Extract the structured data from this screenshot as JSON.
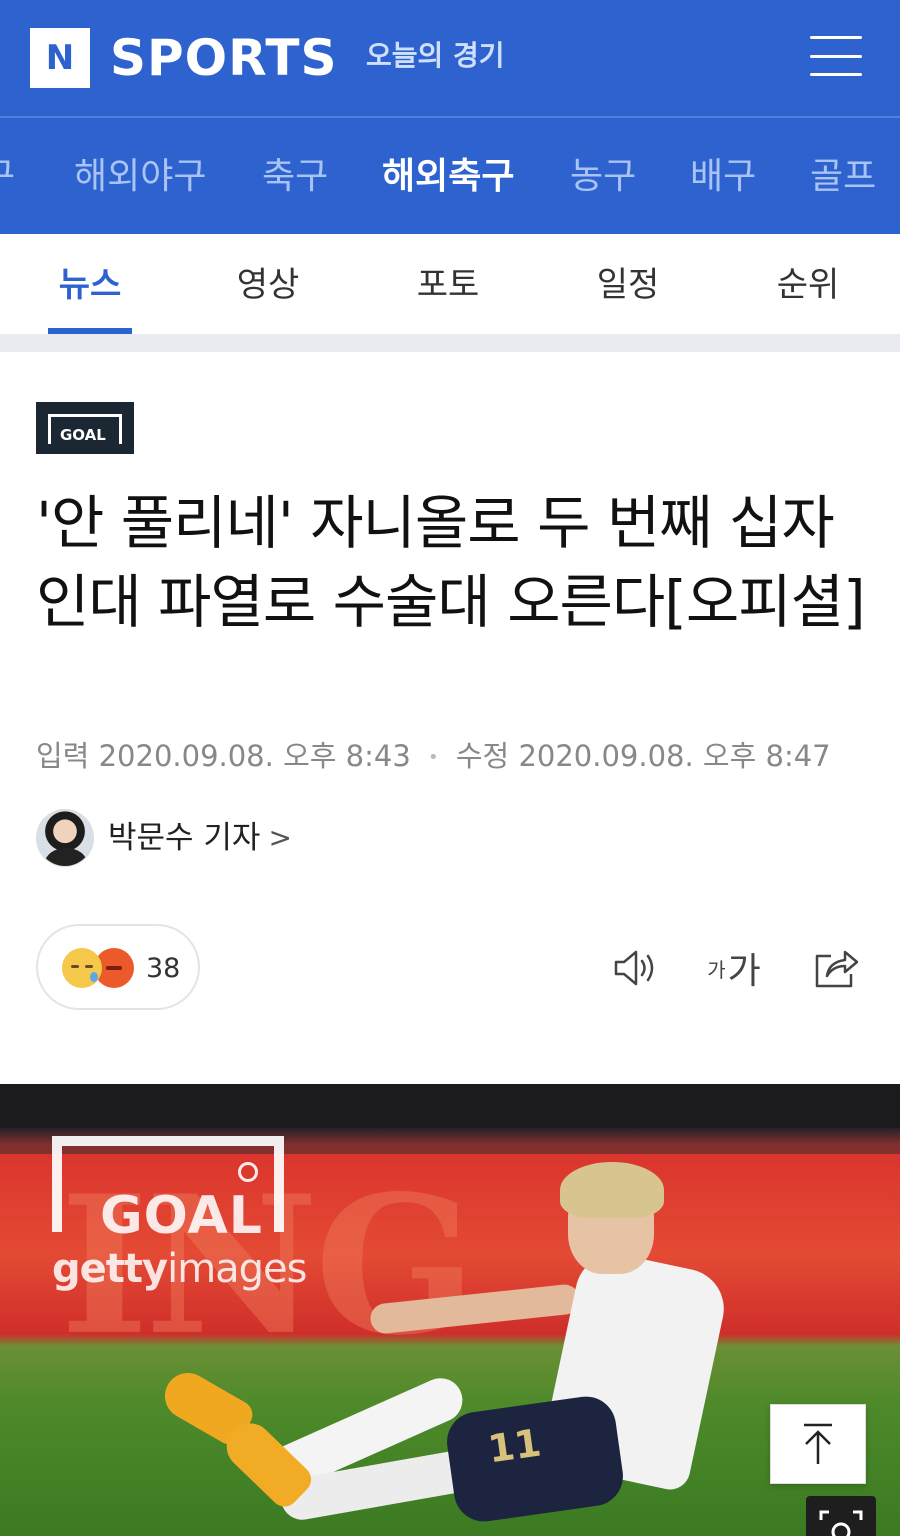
{
  "header": {
    "logo_letter": "N",
    "brand": "SPORTS",
    "today_link": "오늘의 경기",
    "menu_icon": "hamburger-menu-icon",
    "brand_color": "#2e63cf"
  },
  "sport_nav": {
    "items": [
      {
        "label": "구"
      },
      {
        "label": "해외야구"
      },
      {
        "label": "축구"
      },
      {
        "label": "해외축구",
        "active": true
      },
      {
        "label": "농구"
      },
      {
        "label": "배구"
      },
      {
        "label": "골프"
      }
    ]
  },
  "sub_tabs": {
    "items": [
      {
        "label": "뉴스",
        "active": true
      },
      {
        "label": "영상"
      },
      {
        "label": "포토"
      },
      {
        "label": "일정"
      },
      {
        "label": "순위"
      }
    ]
  },
  "article": {
    "press_logo_text": "GOAL",
    "headline": "'안 풀리네' 자니올로 두 번째 십자인대 파열로 수술대 오른다[오피셜]",
    "input_label": "입력",
    "input_time": "2020.09.08. 오후 8:43",
    "modified_label": "수정",
    "modified_time": "2020.09.08. 오후 8:47",
    "reporter": "박문수 기자",
    "reporter_arrow": ">",
    "reaction_count": "38",
    "reaction_icons": [
      "sad-emoji-icon",
      "angry-emoji-icon"
    ],
    "tools": [
      "speaker-icon",
      "font-size-icon",
      "share-icon"
    ],
    "font_size_small": "가",
    "font_size_large": "가"
  },
  "photo": {
    "watermark_goal": "GOAL",
    "watermark_getty_bold": "getty",
    "watermark_getty_light": "images",
    "background_text": "ING",
    "jersey_number": "11"
  },
  "floating": {
    "to_top_icon": "arrow-up-icon",
    "capture_icon": "capture-icon"
  }
}
